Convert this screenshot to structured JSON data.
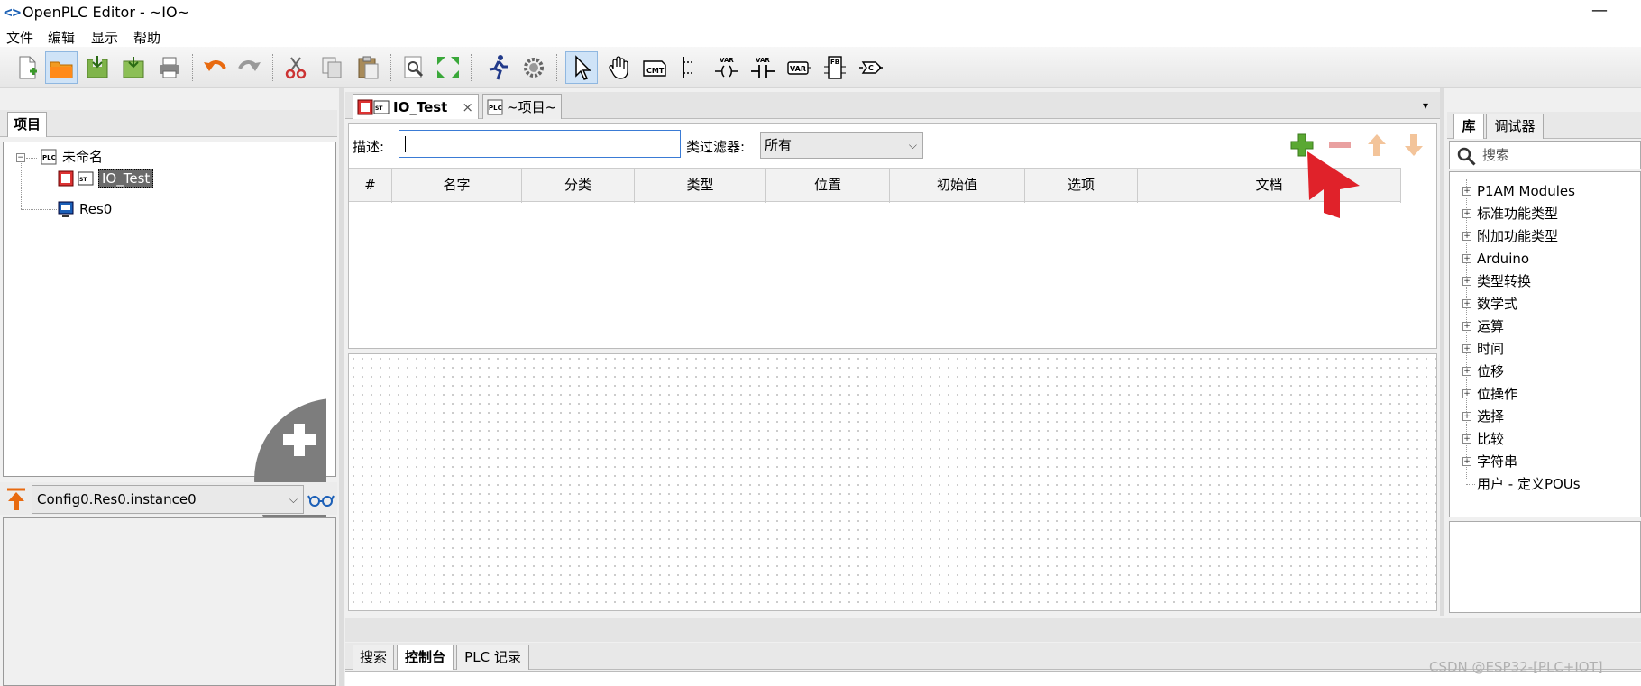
{
  "window": {
    "title": "OpenPLC Editor - ~IO~",
    "logo": "<>",
    "minimize": "—"
  },
  "menu": [
    "文件",
    "编辑",
    "显示",
    "帮助"
  ],
  "project_panel": {
    "tab_label": "项目",
    "tree": [
      {
        "label": "未命名"
      },
      {
        "label": "IO_Test"
      },
      {
        "label": "Res0"
      }
    ],
    "instance_selected": "Config0.Res0.instance0"
  },
  "editor": {
    "tabs": [
      {
        "label": "IO_Test",
        "close": "×"
      },
      {
        "label": "~项目~"
      }
    ],
    "description_label": "描述:",
    "description_value": "",
    "filter_label": "类过滤器:",
    "filter_value": "所有",
    "columns": [
      "#",
      "名字",
      "分类",
      "类型",
      "位置",
      "初始值",
      "选项",
      "文档"
    ],
    "tabs_menu": "▾"
  },
  "bottom_panel": {
    "tabs": [
      "搜索",
      "控制台",
      "PLC 记录"
    ]
  },
  "library_panel": {
    "tabs": [
      "库",
      "调试器"
    ],
    "search_placeholder": "搜索",
    "items": [
      {
        "label": "P1AM Modules",
        "expandable": true
      },
      {
        "label": "标准功能类型",
        "expandable": true
      },
      {
        "label": "附加功能类型",
        "expandable": true
      },
      {
        "label": "Arduino",
        "expandable": true
      },
      {
        "label": "类型转换",
        "expandable": true
      },
      {
        "label": "数学式",
        "expandable": true
      },
      {
        "label": "运算",
        "expandable": true
      },
      {
        "label": "时间",
        "expandable": true
      },
      {
        "label": "位移",
        "expandable": true
      },
      {
        "label": "位操作",
        "expandable": true
      },
      {
        "label": "选择",
        "expandable": true
      },
      {
        "label": "比较",
        "expandable": true
      },
      {
        "label": "字符串",
        "expandable": true
      },
      {
        "label": "用户 - 定义POUs",
        "expandable": false
      }
    ]
  },
  "watermark": "CSDN @ESP32-[PLC+IOT]",
  "colors": {
    "accent_green": "#5aa832",
    "arrow_red": "#e0222a",
    "selection": "#6a6a6a"
  }
}
